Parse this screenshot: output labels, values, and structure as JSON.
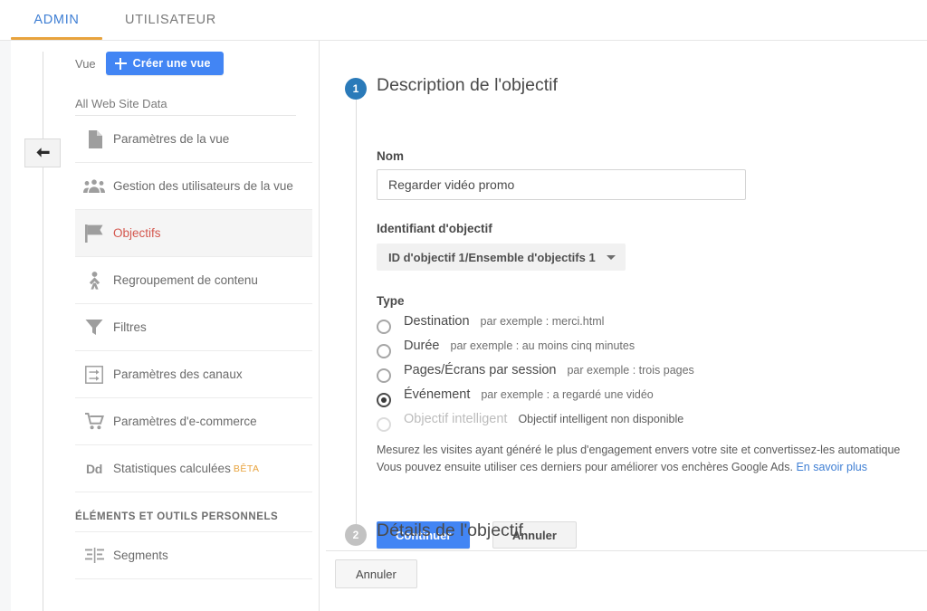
{
  "tabs": [
    {
      "label": "ADMIN",
      "active": true
    },
    {
      "label": "UTILISATEUR",
      "active": false
    }
  ],
  "sidebar": {
    "view_label": "Vue",
    "create_view_button": "Créer une vue",
    "view_name": "All Web Site Data",
    "items": [
      {
        "label": "Paramètres de la vue",
        "icon": "document-icon",
        "selected": false
      },
      {
        "label": "Gestion des utilisateurs de la vue",
        "icon": "people-icon",
        "selected": false
      },
      {
        "label": "Objectifs",
        "icon": "flag-icon",
        "selected": true
      },
      {
        "label": "Regroupement de contenu",
        "icon": "content-grouping-icon",
        "selected": false
      },
      {
        "label": "Filtres",
        "icon": "funnel-icon",
        "selected": false
      },
      {
        "label": "Paramètres des canaux",
        "icon": "channels-icon",
        "selected": false
      },
      {
        "label": "Paramètres d'e-commerce",
        "icon": "cart-icon",
        "selected": false
      },
      {
        "label": "Statistiques calculées",
        "icon": "dd-icon",
        "badge": "BÊTA",
        "selected": false
      }
    ],
    "section_title": "ÉLÉMENTS ET OUTILS PERSONNELS",
    "personal_items": [
      {
        "label": "Segments",
        "icon": "segments-icon",
        "selected": false
      }
    ]
  },
  "main": {
    "step1": {
      "number": "1",
      "title": "Description de l'objectif"
    },
    "step2": {
      "number": "2",
      "title": "Détails de l'objectif"
    },
    "name_field": {
      "label": "Nom",
      "value": "Regarder vidéo promo",
      "placeholder": ""
    },
    "goal_id": {
      "label": "Identifiant d'objectif",
      "selected": "ID d'objectif 1/Ensemble d'objectifs 1"
    },
    "type": {
      "label": "Type",
      "options": [
        {
          "name": "Destination",
          "hint": "par exemple : merci.html",
          "checked": false,
          "disabled": false
        },
        {
          "name": "Durée",
          "hint": "par exemple : au moins cinq minutes",
          "checked": false,
          "disabled": false
        },
        {
          "name": "Pages/Écrans par session",
          "hint": "par exemple : trois pages",
          "checked": false,
          "disabled": false
        },
        {
          "name": "Événement",
          "hint": "par exemple : a regardé une vidéo",
          "checked": true,
          "disabled": false
        },
        {
          "name": "Objectif intelligent",
          "hint": "Objectif intelligent non disponible",
          "checked": false,
          "disabled": true
        }
      ]
    },
    "smart_goal_description": {
      "line1": "Mesurez les visites ayant généré le plus d'engagement envers votre site et convertissez-les automatique",
      "line2": "Vous pouvez ensuite utiliser ces derniers pour améliorer vos enchères Google Ads.",
      "link": "En savoir plus"
    },
    "buttons": {
      "continue": "Continuer",
      "cancel": "Annuler",
      "bottom_cancel": "Annuler"
    }
  },
  "colors": {
    "accent_blue": "#4285f4",
    "tab_active": "#3f7fd4",
    "tab_underline": "#e8a33d",
    "selected_item": "#d4574e",
    "step_active": "#2a7ab9",
    "step_inactive": "#c2c2c2",
    "beta_badge": "#e8a33d"
  }
}
